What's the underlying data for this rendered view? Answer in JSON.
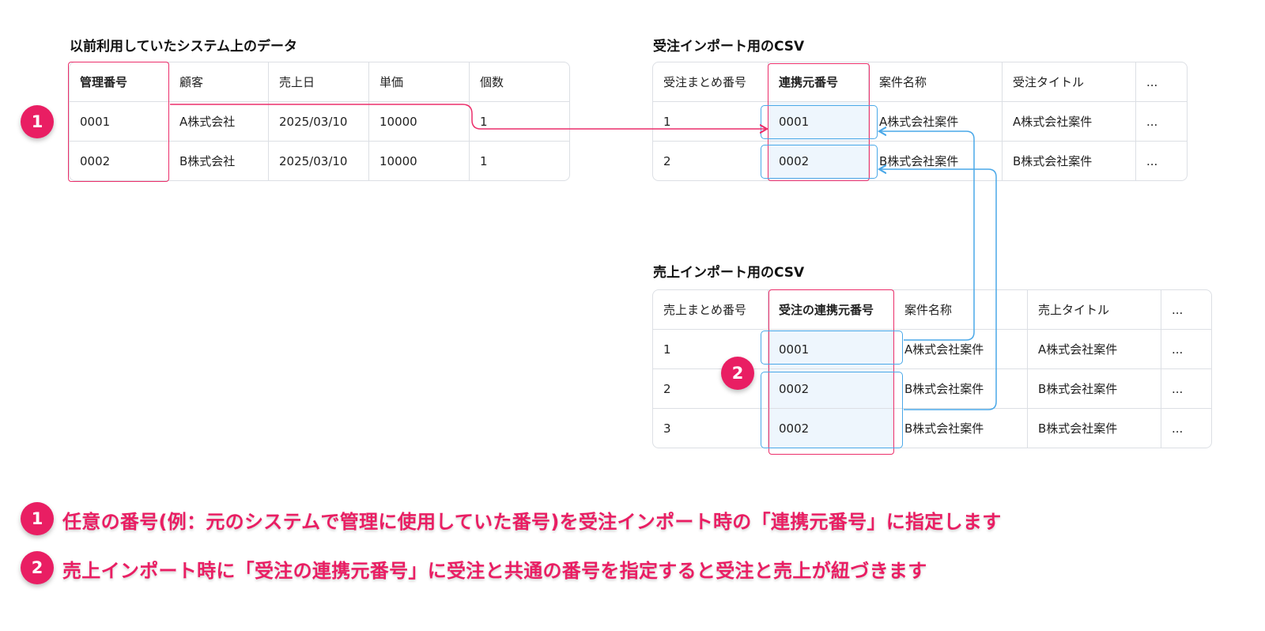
{
  "legacy": {
    "title": "以前利用していたシステム上のデータ",
    "headers": [
      "管理番号",
      "顧客",
      "売上日",
      "単価",
      "個数"
    ],
    "rows": [
      [
        "0001",
        "A株式会社",
        "2025/03/10",
        "10000",
        "1"
      ],
      [
        "0002",
        "B株式会社",
        "2025/03/10",
        "10000",
        "1"
      ]
    ]
  },
  "order_csv": {
    "title": "受注インポート用のCSV",
    "headers": [
      "受注まとめ番号",
      "連携元番号",
      "案件名称",
      "受注タイトル",
      "..."
    ],
    "rows": [
      [
        "1",
        "0001",
        "A株式会社案件",
        "A株式会社案件",
        "..."
      ],
      [
        "2",
        "0002",
        "B株式会社案件",
        "B株式会社案件",
        "..."
      ]
    ]
  },
  "sales_csv": {
    "title": "売上インポート用のCSV",
    "headers": [
      "売上まとめ番号",
      "受注の連携元番号",
      "案件名称",
      "売上タイトル",
      "..."
    ],
    "rows": [
      [
        "1",
        "0001",
        "A株式会社案件",
        "A株式会社案件",
        "..."
      ],
      [
        "2",
        "0002",
        "B株式会社案件",
        "B株式会社案件",
        "..."
      ],
      [
        "3",
        "0002",
        "B株式会社案件",
        "B株式会社案件",
        "..."
      ]
    ]
  },
  "badges": [
    "1",
    "2"
  ],
  "notes": [
    {
      "number": "1",
      "text": "任意の番号(例：元のシステムで管理に使用していた番号)を受注インポート時の「連携元番号」に指定します"
    },
    {
      "number": "2",
      "text": "売上インポート時に「受注の連携元番号」に受注と共通の番号を指定すると受注と売上が紐づきます"
    }
  ],
  "colors": {
    "accent": "#e91e63",
    "link_blue": "#4aa8e8",
    "highlight_red": "#ec2f6b"
  }
}
